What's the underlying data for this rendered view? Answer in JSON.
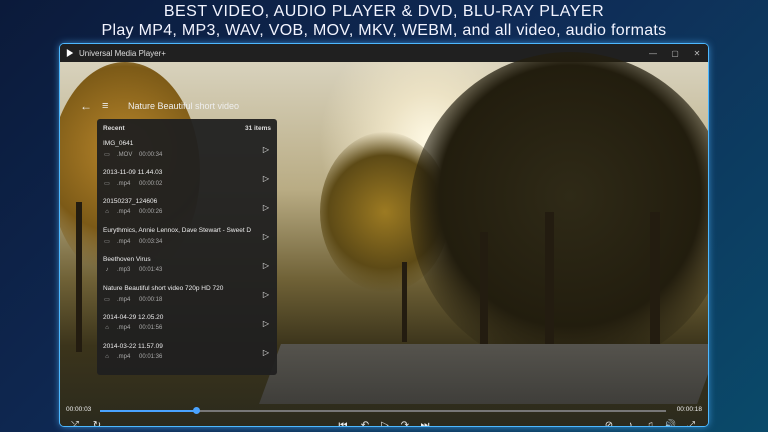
{
  "promo": {
    "line1": "BEST VIDEO, AUDIO PLAYER & DVD, BLU-RAY PLAYER",
    "line2": "Play MP4, MP3, WAV, VOB, MOV, MKV, WEBM, and all video, audio formats"
  },
  "window": {
    "title": "Universal Media Player+",
    "minimize": "—",
    "maximize": "▢",
    "close": "✕"
  },
  "player": {
    "now_playing": "Nature Beautiful short video",
    "current_time": "00:00:03",
    "total_time": "00:00:18",
    "progress": 0.17,
    "accent": "#4aa3ff"
  },
  "recent": {
    "header": "Recent",
    "count": "31 items",
    "items": [
      {
        "name": "IMG_0641",
        "type_icon": "video-icon",
        "ext": ".MOV",
        "duration": "00:00:34"
      },
      {
        "name": "2013-11-09 11.44.03",
        "type_icon": "video-icon",
        "ext": ".mp4",
        "duration": "00:00:02"
      },
      {
        "name": "20150237_124606",
        "type_icon": "lock-icon",
        "ext": ".mp4",
        "duration": "00:00:26"
      },
      {
        "name": "Eurythmics, Annie Lennox, Dave Stewart - Sweet D",
        "type_icon": "video-icon",
        "ext": ".mp4",
        "duration": "00:03:34"
      },
      {
        "name": "Beethoven Virus",
        "type_icon": "music-icon",
        "ext": ".mp3",
        "duration": "00:01:43"
      },
      {
        "name": "Nature Beautiful short video 720p HD 720",
        "type_icon": "video-icon",
        "ext": ".mp4",
        "duration": "00:00:18"
      },
      {
        "name": "2014-04-29 12.05.20",
        "type_icon": "lock-icon",
        "ext": ".mp4",
        "duration": "00:01:56"
      },
      {
        "name": "2014-03-22 11.57.09",
        "type_icon": "lock-icon",
        "ext": ".mp4",
        "duration": "00:01:36"
      }
    ]
  },
  "icons": {
    "back": "←",
    "playlist": "≡",
    "play": "▷",
    "shuffle": "⤮",
    "repeat": "↻",
    "prev": "⏮",
    "rewind": "↶",
    "play_main": "▷",
    "forward": "↷",
    "next": "⏭",
    "subtitle_off": "⊘",
    "audio_track": "♪",
    "speed": "♫",
    "volume": "🔊",
    "fullscreen": "⤢"
  }
}
